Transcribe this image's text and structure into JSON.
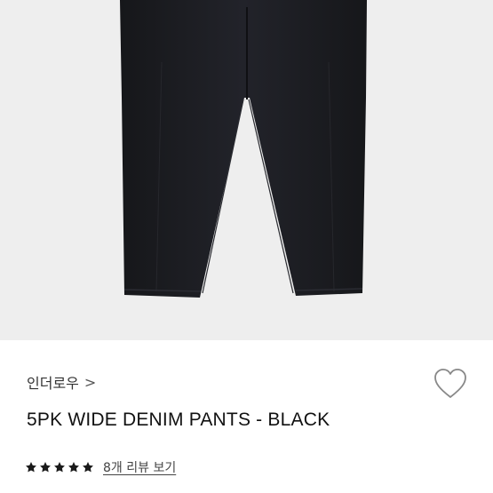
{
  "product": {
    "brand": "인더로우",
    "brand_chevron": ">",
    "title": "5PK WIDE DENIM PANTS - BLACK",
    "rating": 5,
    "rating_max": 5,
    "review_link": "8개 리뷰 보기",
    "wishlist_icon": "heart-outline-icon"
  },
  "colors": {
    "image_background": "#eeeeee",
    "pants": "#1b1c1f",
    "star": "#1a1a1a"
  }
}
